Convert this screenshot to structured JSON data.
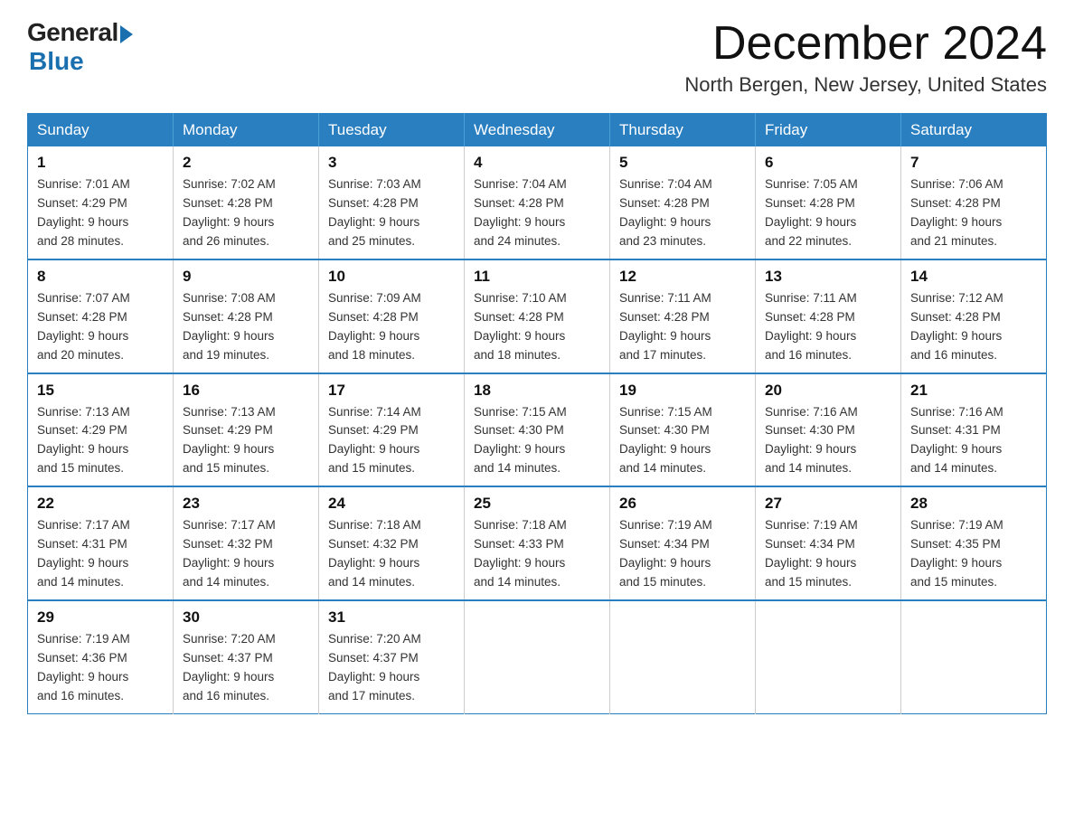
{
  "header": {
    "logo_general": "General",
    "logo_blue": "Blue",
    "month_title": "December 2024",
    "location": "North Bergen, New Jersey, United States"
  },
  "weekdays": [
    "Sunday",
    "Monday",
    "Tuesday",
    "Wednesday",
    "Thursday",
    "Friday",
    "Saturday"
  ],
  "weeks": [
    [
      {
        "day": "1",
        "sunrise": "7:01 AM",
        "sunset": "4:29 PM",
        "daylight": "9 hours and 28 minutes."
      },
      {
        "day": "2",
        "sunrise": "7:02 AM",
        "sunset": "4:28 PM",
        "daylight": "9 hours and 26 minutes."
      },
      {
        "day": "3",
        "sunrise": "7:03 AM",
        "sunset": "4:28 PM",
        "daylight": "9 hours and 25 minutes."
      },
      {
        "day": "4",
        "sunrise": "7:04 AM",
        "sunset": "4:28 PM",
        "daylight": "9 hours and 24 minutes."
      },
      {
        "day": "5",
        "sunrise": "7:04 AM",
        "sunset": "4:28 PM",
        "daylight": "9 hours and 23 minutes."
      },
      {
        "day": "6",
        "sunrise": "7:05 AM",
        "sunset": "4:28 PM",
        "daylight": "9 hours and 22 minutes."
      },
      {
        "day": "7",
        "sunrise": "7:06 AM",
        "sunset": "4:28 PM",
        "daylight": "9 hours and 21 minutes."
      }
    ],
    [
      {
        "day": "8",
        "sunrise": "7:07 AM",
        "sunset": "4:28 PM",
        "daylight": "9 hours and 20 minutes."
      },
      {
        "day": "9",
        "sunrise": "7:08 AM",
        "sunset": "4:28 PM",
        "daylight": "9 hours and 19 minutes."
      },
      {
        "day": "10",
        "sunrise": "7:09 AM",
        "sunset": "4:28 PM",
        "daylight": "9 hours and 18 minutes."
      },
      {
        "day": "11",
        "sunrise": "7:10 AM",
        "sunset": "4:28 PM",
        "daylight": "9 hours and 18 minutes."
      },
      {
        "day": "12",
        "sunrise": "7:11 AM",
        "sunset": "4:28 PM",
        "daylight": "9 hours and 17 minutes."
      },
      {
        "day": "13",
        "sunrise": "7:11 AM",
        "sunset": "4:28 PM",
        "daylight": "9 hours and 16 minutes."
      },
      {
        "day": "14",
        "sunrise": "7:12 AM",
        "sunset": "4:28 PM",
        "daylight": "9 hours and 16 minutes."
      }
    ],
    [
      {
        "day": "15",
        "sunrise": "7:13 AM",
        "sunset": "4:29 PM",
        "daylight": "9 hours and 15 minutes."
      },
      {
        "day": "16",
        "sunrise": "7:13 AM",
        "sunset": "4:29 PM",
        "daylight": "9 hours and 15 minutes."
      },
      {
        "day": "17",
        "sunrise": "7:14 AM",
        "sunset": "4:29 PM",
        "daylight": "9 hours and 15 minutes."
      },
      {
        "day": "18",
        "sunrise": "7:15 AM",
        "sunset": "4:30 PM",
        "daylight": "9 hours and 14 minutes."
      },
      {
        "day": "19",
        "sunrise": "7:15 AM",
        "sunset": "4:30 PM",
        "daylight": "9 hours and 14 minutes."
      },
      {
        "day": "20",
        "sunrise": "7:16 AM",
        "sunset": "4:30 PM",
        "daylight": "9 hours and 14 minutes."
      },
      {
        "day": "21",
        "sunrise": "7:16 AM",
        "sunset": "4:31 PM",
        "daylight": "9 hours and 14 minutes."
      }
    ],
    [
      {
        "day": "22",
        "sunrise": "7:17 AM",
        "sunset": "4:31 PM",
        "daylight": "9 hours and 14 minutes."
      },
      {
        "day": "23",
        "sunrise": "7:17 AM",
        "sunset": "4:32 PM",
        "daylight": "9 hours and 14 minutes."
      },
      {
        "day": "24",
        "sunrise": "7:18 AM",
        "sunset": "4:32 PM",
        "daylight": "9 hours and 14 minutes."
      },
      {
        "day": "25",
        "sunrise": "7:18 AM",
        "sunset": "4:33 PM",
        "daylight": "9 hours and 14 minutes."
      },
      {
        "day": "26",
        "sunrise": "7:19 AM",
        "sunset": "4:34 PM",
        "daylight": "9 hours and 15 minutes."
      },
      {
        "day": "27",
        "sunrise": "7:19 AM",
        "sunset": "4:34 PM",
        "daylight": "9 hours and 15 minutes."
      },
      {
        "day": "28",
        "sunrise": "7:19 AM",
        "sunset": "4:35 PM",
        "daylight": "9 hours and 15 minutes."
      }
    ],
    [
      {
        "day": "29",
        "sunrise": "7:19 AM",
        "sunset": "4:36 PM",
        "daylight": "9 hours and 16 minutes."
      },
      {
        "day": "30",
        "sunrise": "7:20 AM",
        "sunset": "4:37 PM",
        "daylight": "9 hours and 16 minutes."
      },
      {
        "day": "31",
        "sunrise": "7:20 AM",
        "sunset": "4:37 PM",
        "daylight": "9 hours and 17 minutes."
      },
      null,
      null,
      null,
      null
    ]
  ],
  "labels": {
    "sunrise_prefix": "Sunrise: ",
    "sunset_prefix": "Sunset: ",
    "daylight_prefix": "Daylight: "
  }
}
